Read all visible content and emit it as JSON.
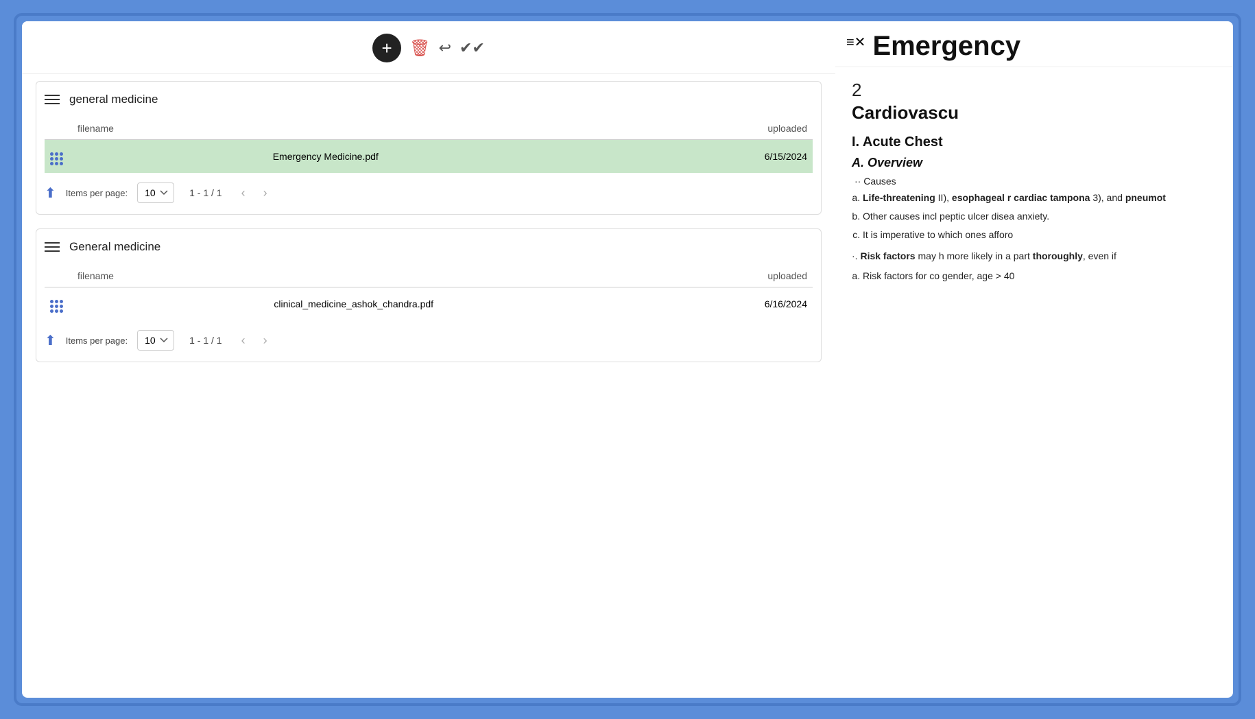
{
  "toolbar": {
    "add_label": "+",
    "delete_label": "🗑",
    "undo_label": "↩",
    "check_label": "✔✔"
  },
  "sections": [
    {
      "id": "section-1",
      "title": "general medicine",
      "columns": {
        "filename": "filename",
        "uploaded": "uploaded"
      },
      "files": [
        {
          "name": "Emergency Medicine.pdf",
          "uploaded": "6/15/2024",
          "selected": true
        }
      ],
      "pagination": {
        "items_per_page_label": "Items per page:",
        "items_per_page_value": "10",
        "page_info": "1 - 1 / 1"
      }
    },
    {
      "id": "section-2",
      "title": "General medicine",
      "columns": {
        "filename": "filename",
        "uploaded": "uploaded"
      },
      "files": [
        {
          "name": "clinical_medicine_ashok_chandra.pdf",
          "uploaded": "6/16/2024",
          "selected": false
        }
      ],
      "pagination": {
        "items_per_page_label": "Items per page:",
        "items_per_page_value": "10",
        "page_info": "1 - 1 / 1"
      }
    }
  ],
  "right_panel": {
    "menu_icon": "≡",
    "title": "Emergency",
    "chapter_num": "2",
    "chapter_title": "Cardiovascu",
    "section_heading": "I. Acute Chest",
    "subsection_heading": "A. Overview",
    "causes_label": "·· Causes",
    "list_items": [
      {
        "label": "a.",
        "text": "Life-threatening II), esophageal r cardiac tampona 3), and pneumot",
        "bold_parts": [
          "Life-threatening",
          "esophageal r",
          "cardiac tampona",
          "pneumot"
        ]
      },
      {
        "label": "b.",
        "text": "Other causes incl peptic ulcer disea anxiety."
      },
      {
        "label": "c.",
        "text": "It is imperative to which ones afforo"
      }
    ],
    "risk_factors_label": "·. Risk factors may h more likely in a part thoroughly, even if",
    "risk_factors_bold": "Risk factors",
    "risk_factors_bold2": "thoroughly",
    "sub_list": [
      {
        "label": "a.",
        "text": "Risk factors for co gender, age > 40"
      }
    ]
  }
}
